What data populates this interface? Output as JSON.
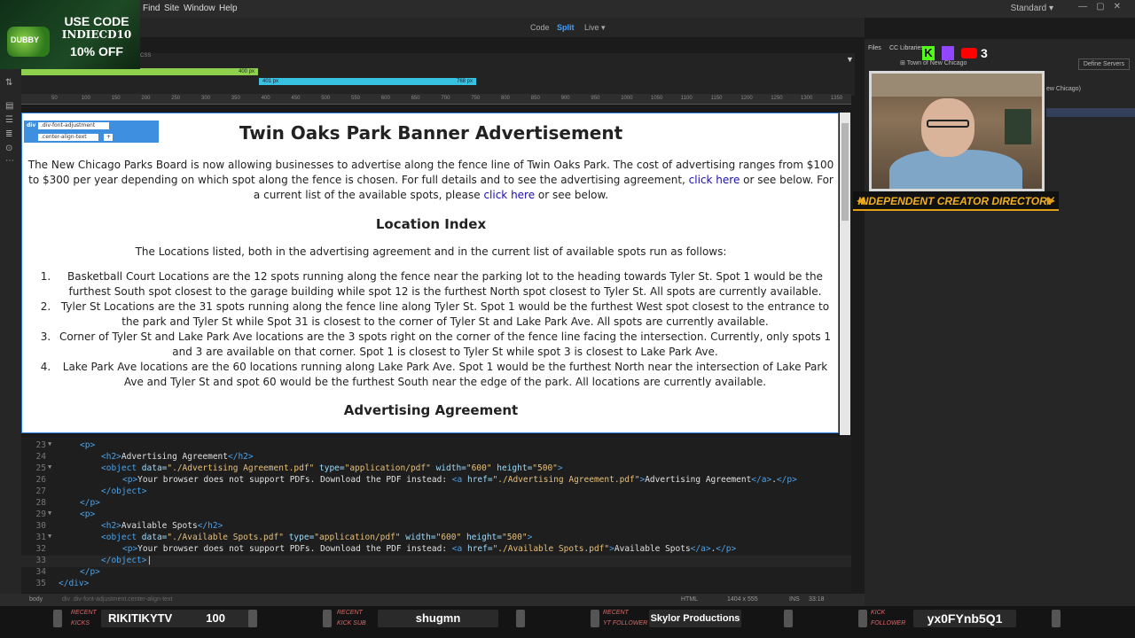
{
  "menu": {
    "items": [
      "Find",
      "Site",
      "Window",
      "Help"
    ],
    "workspace": "Standard"
  },
  "promo": {
    "line1": "USE CODE",
    "line2": "INDIECD10",
    "line3": "10% OFF",
    "logo": "DUBBY"
  },
  "viewbar": {
    "code": "Code",
    "split": "Split",
    "live": "Live"
  },
  "mq": {
    "bar1_label": "400 px",
    "bar2_left": "401 px",
    "bar2_right": "768 px",
    "ruler": [
      "50",
      "100",
      "150",
      "200",
      "250",
      "300",
      "350",
      "400",
      "450",
      "500",
      "550",
      "600",
      "650",
      "700",
      "750",
      "800",
      "850",
      "900",
      "950",
      "1000",
      "1050",
      "1100",
      "1150",
      "1200",
      "1250",
      "1300",
      "1350"
    ]
  },
  "live": {
    "badge_tag": "div",
    "badge_class1": ".div-font-adjustment",
    "badge_class2": ".center-align-text",
    "badge_add": "+",
    "title": "Twin Oaks Park Banner Advertisement",
    "intro_part1": "The New Chicago Parks Board is now allowing businesses to advertise along the fence line of Twin Oaks Park. The cost of advertising ranges from $100 to $300 per year depending on which spot along the fence is chosen. For full details and to see the advertising agreement, ",
    "intro_link1": "click here",
    "intro_part2": " or see below. For a current list of the available spots, please ",
    "intro_link2": "click here",
    "intro_part3": " or see below.",
    "location_heading": "Location Index",
    "locations_intro": "The Locations listed, both in the advertising agreement and in the current list of available spots run as follows:",
    "locations": [
      "Basketball Court Locations are the 12 spots running along the fence near the parking lot to the heading towards Tyler St. Spot 1 would be the furthest South spot closest to the garage building while spot 12 is the furthest North spot closest to Tyler St. All spots are currently available.",
      "Tyler St Locations are the 31 spots running along the fence line along Tyler St. Spot 1 would be the furthest West spot closest to the entrance to the park and Tyler St while Spot 31 is closest to the corner of Tyler St and Lake Park Ave. All spots are currently available.",
      "Corner of Tyler St and Lake Park Ave locations are the 3 spots right on the corner of the fence line facing the intersection. Currently, only spots 1 and 3 are available on that corner. Spot 1 is closest to Tyler St while spot 3 is closest to Lake Park Ave.",
      "Lake Park Ave locations are the 60 locations running along Lake Park Ave. Spot 1 would be the furthest North near the intersection of Lake Park Ave and Tyler St and spot 60 would be the furthest South near the edge of the park. All locations are currently available."
    ],
    "agreement_heading": "Advertising Agreement"
  },
  "code": {
    "lines": [
      {
        "n": "23",
        "fold": "▼",
        "indent": 1,
        "html": "<span class=\"tag\">&lt;p&gt;</span>"
      },
      {
        "n": "24",
        "fold": "",
        "indent": 2,
        "html": "<span class=\"tag\">&lt;h2&gt;</span><span class=\"txt\">Advertising Agreement</span><span class=\"tag\">&lt;/h2&gt;</span>"
      },
      {
        "n": "25",
        "fold": "▼",
        "indent": 2,
        "html": "<span class=\"tag\">&lt;object</span> <span class=\"att\">data=</span><span class=\"val\">\"./Advertising Agreement.pdf\"</span> <span class=\"att\">type=</span><span class=\"val\">\"application/pdf\"</span> <span class=\"att\">width=</span><span class=\"val\">\"600\"</span> <span class=\"att\">height=</span><span class=\"val\">\"500\"</span><span class=\"tag\">&gt;</span>"
      },
      {
        "n": "26",
        "fold": "",
        "indent": 3,
        "html": "<span class=\"tag\">&lt;p&gt;</span><span class=\"txt\">Your browser does not support PDFs. Download the PDF instead: </span><span class=\"tag\">&lt;a</span> <span class=\"att\">href=</span><span class=\"val\">\"./Advertising Agreement.pdf\"</span><span class=\"tag\">&gt;</span><span class=\"txt\">Advertising Agreement</span><span class=\"tag\">&lt;/a&gt;</span><span class=\"txt\">.</span><span class=\"tag\">&lt;/p&gt;</span>"
      },
      {
        "n": "27",
        "fold": "",
        "indent": 2,
        "html": "<span class=\"tag\">&lt;/object&gt;</span>"
      },
      {
        "n": "28",
        "fold": "",
        "indent": 1,
        "html": "<span class=\"tag\">&lt;/p&gt;</span>"
      },
      {
        "n": "29",
        "fold": "▼",
        "indent": 1,
        "html": "<span class=\"tag\">&lt;p&gt;</span>"
      },
      {
        "n": "30",
        "fold": "",
        "indent": 2,
        "html": "<span class=\"tag\">&lt;h2&gt;</span><span class=\"txt\">Available Spots</span><span class=\"tag\">&lt;/h2&gt;</span>"
      },
      {
        "n": "31",
        "fold": "▼",
        "indent": 2,
        "html": "<span class=\"tag\">&lt;object</span> <span class=\"att\">data=</span><span class=\"val\">\"./Available Spots.pdf\"</span> <span class=\"att\">type=</span><span class=\"val\">\"application/pdf\"</span> <span class=\"att\">width=</span><span class=\"val\">\"600\"</span> <span class=\"att\">height=</span><span class=\"val\">\"500\"</span><span class=\"tag\">&gt;</span>"
      },
      {
        "n": "32",
        "fold": "",
        "indent": 3,
        "html": "<span class=\"tag\">&lt;p&gt;</span><span class=\"txt\">Your browser does not support PDFs. Download the PDF instead: </span><span class=\"tag\">&lt;a</span> <span class=\"att\">href=</span><span class=\"val\">\"./Available Spots.pdf\"</span><span class=\"tag\">&gt;</span><span class=\"txt\">Available Spots</span><span class=\"tag\">&lt;/a&gt;</span><span class=\"txt\">.</span><span class=\"tag\">&lt;/p&gt;</span>"
      },
      {
        "n": "33",
        "fold": "",
        "indent": 2,
        "html": "<span class=\"tag\">&lt;/object&gt;</span><span class=\"txt\">|</span>"
      },
      {
        "n": "34",
        "fold": "",
        "indent": 1,
        "html": "<span class=\"tag\">&lt;/p&gt;</span>"
      },
      {
        "n": "35",
        "fold": "",
        "indent": 0,
        "html": "<span class=\"tag\">&lt;/div&gt;</span>"
      }
    ]
  },
  "status": {
    "body": "body",
    "path": "div  .div-font-adjustment.center-align-text",
    "lang": "HTML",
    "size": "1404 x 555",
    "ins": "INS",
    "pos": "33:18"
  },
  "rpanel": {
    "files": "Files",
    "cclib": "CC Libraries",
    "site": "Town of New Chicago",
    "site_tail": "ew Chicago)",
    "define_servers": "Define Servers"
  },
  "social": {
    "k": "K",
    "count": "3"
  },
  "creator_dir": "INDEPENDENT CREATOR DIRECTORY",
  "alerts": [
    {
      "tag_line1": "RECENT",
      "tag_line2": "KICKS",
      "name": "RIKITIKYTV",
      "amount": "100"
    },
    {
      "tag_line1": "RECENT",
      "tag_line2": "KICK SUB",
      "name": "shugmn"
    },
    {
      "tag_line1": "RECENT",
      "tag_line2": "YT FOLLOWER",
      "name": "Skylor Productions"
    },
    {
      "tag_line1": "KICK",
      "tag_line2": "FOLLOWER",
      "name": "yx0FYnb5Q1"
    }
  ],
  "colors": {
    "accent": "#41a0ff",
    "mq_green": "#8fd14f",
    "mq_cyan": "#36c2e0",
    "link": "#1a0dab"
  }
}
